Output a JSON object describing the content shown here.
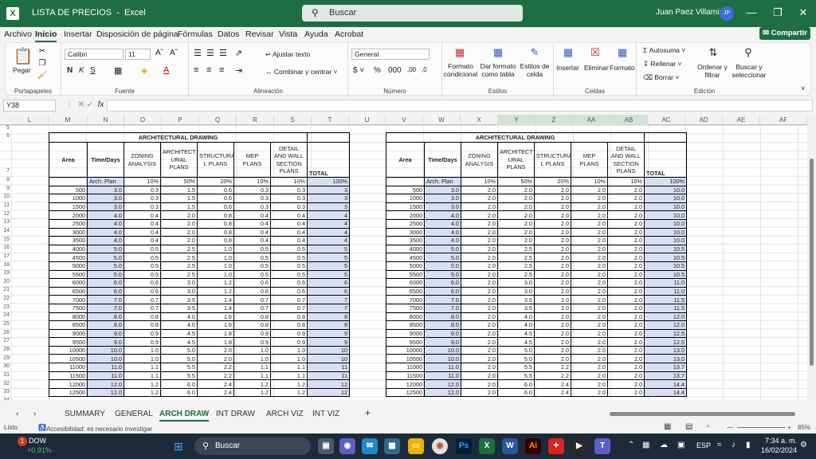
{
  "window": {
    "filename": "LISTA DE PRECIOS",
    "app": "Excel",
    "search_placeholder": "Buscar",
    "user": "Juan  Paez Villamizar",
    "user_initials": "JP"
  },
  "menu": [
    "Archivo",
    "Inicio",
    "Insertar",
    "Disposición de página",
    "Fórmulas",
    "Datos",
    "Revisar",
    "Vista",
    "Ayuda",
    "Acrobat"
  ],
  "share_label": "Compartir",
  "ribbon": {
    "portapapeles": {
      "label": "Portapapeles",
      "pegar": "Pegar"
    },
    "fuente": {
      "label": "Fuente",
      "font": "Calibri",
      "size": "11"
    },
    "alineacion": {
      "label": "Alineación",
      "ajustar": "Ajustar texto",
      "combinar": "Combinar y centrar"
    },
    "numero": {
      "label": "Número",
      "format": "General"
    },
    "estilos": {
      "label": "Estilos",
      "formato_condicional": "Formato condicional",
      "dar_formato": "Dar formato como tabla",
      "estilos_celda": "Estilos de celda"
    },
    "celdas": {
      "label": "Celdas",
      "insertar": "Insertar",
      "eliminar": "Eliminar",
      "formato": "Formato"
    },
    "edicion": {
      "label": "Edición",
      "autosuma": "Autosuma",
      "rellenar": "Rellenar",
      "borrar": "Borrar",
      "ordenar": "Ordenar y filtrar",
      "buscar": "Buscar y seleccionar"
    }
  },
  "name_box": "Y38",
  "columns": [
    "L",
    "M",
    "N",
    "O",
    "P",
    "Q",
    "R",
    "S",
    "T",
    "U",
    "V",
    "W",
    "X",
    "Y",
    "Z",
    "AA",
    "AB",
    "AC",
    "AD",
    "AE",
    "AF"
  ],
  "highlighted_columns": [
    "Y",
    "Z",
    "AA",
    "AB"
  ],
  "row_numbers": [
    "5",
    "6",
    "7",
    "8",
    "9",
    "10",
    "11",
    "12",
    "13",
    "14",
    "15",
    "16",
    "17",
    "18",
    "19",
    "20",
    "21",
    "22",
    "23",
    "24",
    "25",
    "26",
    "27",
    "28",
    "29",
    "30",
    "31",
    "32",
    "33",
    "34"
  ],
  "table1": {
    "title": "ARCHITECTURAL DRAWING",
    "headers": [
      "Area",
      "Time/Days",
      "ZONING ANALYSIS",
      "ARCHITECT URAL PLANS",
      "STRUCTURA L PLANS",
      "MEP PLANS",
      "DETAIL AND WALL SECTION PLANS",
      "TOTAL"
    ],
    "percent_row": [
      "",
      "Arch. Plan",
      "10%",
      "50%",
      "20%",
      "10%",
      "10%",
      "100%"
    ],
    "rows": [
      [
        "500",
        "3.0",
        "0.3",
        "1.5",
        "0.6",
        "0.3",
        "0.3",
        "3"
      ],
      [
        "1000",
        "3.0",
        "0.3",
        "1.5",
        "0.6",
        "0.3",
        "0.3",
        "3"
      ],
      [
        "1500",
        "3.0",
        "0.3",
        "1.5",
        "0.6",
        "0.3",
        "0.3",
        "3"
      ],
      [
        "2000",
        "4.0",
        "0.4",
        "2.0",
        "0.8",
        "0.4",
        "0.4",
        "4"
      ],
      [
        "2500",
        "4.0",
        "0.4",
        "2.0",
        "0.8",
        "0.4",
        "0.4",
        "4"
      ],
      [
        "3000",
        "4.0",
        "0.4",
        "2.0",
        "0.8",
        "0.4",
        "0.4",
        "4"
      ],
      [
        "3500",
        "4.0",
        "0.4",
        "2.0",
        "0.8",
        "0.4",
        "0.4",
        "4"
      ],
      [
        "4000",
        "5.0",
        "0.5",
        "2.5",
        "1.0",
        "0.5",
        "0.5",
        "5"
      ],
      [
        "4500",
        "5.0",
        "0.5",
        "2.5",
        "1.0",
        "0.5",
        "0.5",
        "5"
      ],
      [
        "5000",
        "5.0",
        "0.5",
        "2.5",
        "1.0",
        "0.5",
        "0.5",
        "5"
      ],
      [
        "5500",
        "5.0",
        "0.5",
        "2.5",
        "1.0",
        "0.5",
        "0.5",
        "5"
      ],
      [
        "6000",
        "6.0",
        "0.6",
        "3.0",
        "1.2",
        "0.6",
        "0.6",
        "6"
      ],
      [
        "6500",
        "6.0",
        "0.6",
        "3.0",
        "1.2",
        "0.6",
        "0.6",
        "6"
      ],
      [
        "7000",
        "7.0",
        "0.7",
        "3.5",
        "1.4",
        "0.7",
        "0.7",
        "7"
      ],
      [
        "7500",
        "7.0",
        "0.7",
        "3.5",
        "1.4",
        "0.7",
        "0.7",
        "7"
      ],
      [
        "8000",
        "8.0",
        "0.8",
        "4.0",
        "1.6",
        "0.8",
        "0.8",
        "8"
      ],
      [
        "8500",
        "8.0",
        "0.8",
        "4.0",
        "1.6",
        "0.8",
        "0.8",
        "8"
      ],
      [
        "9000",
        "9.0",
        "0.9",
        "4.5",
        "1.8",
        "0.9",
        "0.9",
        "9"
      ],
      [
        "9500",
        "9.0",
        "0.9",
        "4.5",
        "1.8",
        "0.9",
        "0.9",
        "9"
      ],
      [
        "10000",
        "10.0",
        "1.0",
        "5.0",
        "2.0",
        "1.0",
        "1.0",
        "10"
      ],
      [
        "10500",
        "10.0",
        "1.0",
        "5.0",
        "2.0",
        "1.0",
        "1.0",
        "10"
      ],
      [
        "11000",
        "11.0",
        "1.1",
        "5.5",
        "2.2",
        "1.1",
        "1.1",
        "11"
      ],
      [
        "11500",
        "11.0",
        "1.1",
        "5.5",
        "2.2",
        "1.1",
        "1.1",
        "11"
      ],
      [
        "12000",
        "12.0",
        "1.2",
        "6.0",
        "2.4",
        "1.2",
        "1.2",
        "12"
      ],
      [
        "12500",
        "12.0",
        "1.2",
        "6.0",
        "2.4",
        "1.2",
        "1.2",
        "12"
      ]
    ]
  },
  "table2": {
    "title": "ARCHITECTURAL DRAWING",
    "headers": [
      "Area",
      "Time/Days",
      "ZONING ANALYSIS",
      "ARCHITECT URAL PLANS",
      "STRUCTURA L PLANS",
      "MEP PLANS",
      "DETAIL AND WALL SECTION PLANS",
      "TOTAL"
    ],
    "percent_row": [
      "",
      "Arch. Plan",
      "10%",
      "50%",
      "20%",
      "10%",
      "10%",
      "100%"
    ],
    "rows": [
      [
        "500",
        "3.0",
        "2.0",
        "2.0",
        "2.0",
        "2.0",
        "2.0",
        "10.0"
      ],
      [
        "1000",
        "3.0",
        "2.0",
        "2.0",
        "2.0",
        "2.0",
        "2.0",
        "10.0"
      ],
      [
        "1500",
        "3.0",
        "2.0",
        "2.0",
        "2.0",
        "2.0",
        "2.0",
        "10.0"
      ],
      [
        "2000",
        "4.0",
        "2.0",
        "2.0",
        "2.0",
        "2.0",
        "2.0",
        "10.0"
      ],
      [
        "2500",
        "4.0",
        "2.0",
        "2.0",
        "2.0",
        "2.0",
        "2.0",
        "10.0"
      ],
      [
        "3000",
        "4.0",
        "2.0",
        "2.0",
        "2.0",
        "2.0",
        "2.0",
        "10.0"
      ],
      [
        "3500",
        "4.0",
        "2.0",
        "2.0",
        "2.0",
        "2.0",
        "2.0",
        "10.0"
      ],
      [
        "4000",
        "5.0",
        "2.0",
        "2.5",
        "2.0",
        "2.0",
        "2.0",
        "10.5"
      ],
      [
        "4500",
        "5.0",
        "2.0",
        "2.5",
        "2.0",
        "2.0",
        "2.0",
        "10.5"
      ],
      [
        "5000",
        "5.0",
        "2.0",
        "2.5",
        "2.0",
        "2.0",
        "2.0",
        "10.5"
      ],
      [
        "5500",
        "5.0",
        "2.0",
        "2.5",
        "2.0",
        "2.0",
        "2.0",
        "10.5"
      ],
      [
        "6000",
        "6.0",
        "2.0",
        "3.0",
        "2.0",
        "2.0",
        "2.0",
        "11.0"
      ],
      [
        "6500",
        "6.0",
        "2.0",
        "3.0",
        "2.0",
        "2.0",
        "2.0",
        "11.0"
      ],
      [
        "7000",
        "7.0",
        "2.0",
        "3.5",
        "2.0",
        "2.0",
        "2.0",
        "11.5"
      ],
      [
        "7500",
        "7.0",
        "2.0",
        "3.5",
        "2.0",
        "2.0",
        "2.0",
        "11.5"
      ],
      [
        "8000",
        "8.0",
        "2.0",
        "4.0",
        "2.0",
        "2.0",
        "2.0",
        "12.0"
      ],
      [
        "8500",
        "8.0",
        "2.0",
        "4.0",
        "2.0",
        "2.0",
        "2.0",
        "12.0"
      ],
      [
        "9000",
        "9.0",
        "2.0",
        "4.5",
        "2.0",
        "2.0",
        "2.0",
        "12.5"
      ],
      [
        "9500",
        "9.0",
        "2.0",
        "4.5",
        "2.0",
        "2.0",
        "2.0",
        "12.5"
      ],
      [
        "10000",
        "10.0",
        "2.0",
        "5.0",
        "2.0",
        "2.0",
        "2.0",
        "13.0"
      ],
      [
        "10500",
        "10.0",
        "2.0",
        "5.0",
        "2.0",
        "2.0",
        "2.0",
        "13.0"
      ],
      [
        "11000",
        "11.0",
        "2.0",
        "5.5",
        "2.2",
        "2.0",
        "2.0",
        "13.7"
      ],
      [
        "11500",
        "11.0",
        "2.0",
        "5.5",
        "2.2",
        "2.0",
        "2.0",
        "13.7"
      ],
      [
        "12000",
        "12.0",
        "2.0",
        "6.0",
        "2.4",
        "2.0",
        "2.0",
        "14.4"
      ],
      [
        "12500",
        "12.0",
        "2.0",
        "6.0",
        "2.4",
        "2.0",
        "2.0",
        "14.4"
      ]
    ]
  },
  "sheet_tabs": [
    "SUMMARY",
    "GENERAL",
    "ARCH DRAW",
    "INT DRAW",
    "ARCH VIZ",
    "INT VIZ"
  ],
  "active_tab": "ARCH DRAW",
  "status": {
    "ready": "Listo",
    "accessibility": "Accesibilidad: es necesario investigar",
    "zoom": "85%"
  },
  "taskbar": {
    "stock_name": "DOW",
    "stock_change": "+0.91%",
    "badge": "1",
    "search": "Buscar",
    "lang": "ESP",
    "time": "7:34 a. m.",
    "date": "16/02/2024"
  },
  "colors": {
    "excel_green": "#1f6e43",
    "cell_blue": "#d8dff3"
  }
}
